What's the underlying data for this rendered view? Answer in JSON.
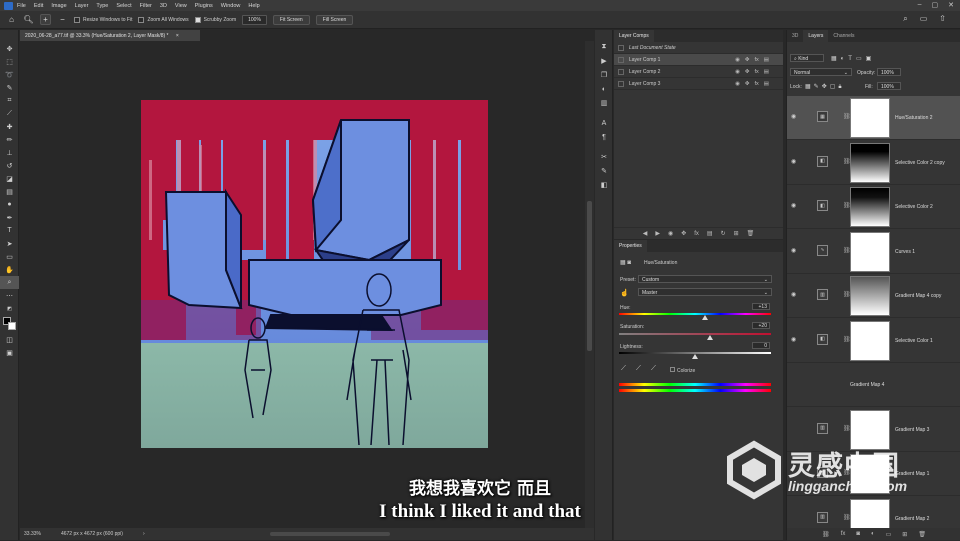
{
  "menubar": {
    "items": [
      "File",
      "Edit",
      "Image",
      "Layer",
      "Type",
      "Select",
      "Filter",
      "3D",
      "View",
      "Plugins",
      "Window",
      "Help"
    ]
  },
  "options": {
    "resize_windows": "Resize Windows to Fit",
    "zoom_all": "Zoom All Windows",
    "scrubby_zoom": "Scrubby Zoom",
    "zoom_value": "100%",
    "fit_screen": "Fit Screen",
    "fill_screen": "Fill Screen"
  },
  "document": {
    "tab_title": "2020_06-28_a77.tif @ 33.3% (Hue/Saturation 2, Layer Mask/8) *",
    "zoom": "33.33%",
    "dimensions": "4672 px x 4672 px (600 ppi)"
  },
  "layer_comps": {
    "tabs": [
      "Layer Comps"
    ],
    "last_state": "Last Document State",
    "items": [
      "Layer Comp 1",
      "Layer Comp 2",
      "Layer Comp 3"
    ]
  },
  "properties": {
    "tab": "Properties",
    "adjustment": "Hue/Saturation",
    "preset_label": "Preset:",
    "preset_value": "Custom",
    "channel_value": "Master",
    "hue_label": "Hue:",
    "hue_value": "+13",
    "saturation_label": "Saturation:",
    "saturation_value": "+20",
    "lightness_label": "Lightness:",
    "lightness_value": "0",
    "colorize_label": "Colorize"
  },
  "layers_panel": {
    "tabs": [
      "3D",
      "Layers",
      "Channels"
    ],
    "kind": "Kind",
    "blend_mode": "Normal",
    "opacity_label": "Opacity:",
    "opacity_value": "100%",
    "lock_label": "Lock:",
    "fill_label": "Fill:",
    "fill_value": "100%",
    "layers": [
      {
        "name": "Hue/Saturation 2",
        "visible": true,
        "selected": true
      },
      {
        "name": "Selective Color 2 copy",
        "visible": true
      },
      {
        "name": "Selective Color 2",
        "visible": true
      },
      {
        "name": "Curves 1",
        "visible": true
      },
      {
        "name": "Gradient Map 4 copy",
        "visible": true
      },
      {
        "name": "Selective Color 1",
        "visible": true
      },
      {
        "name": "Gradient Map 4",
        "visible": false
      },
      {
        "name": "Gradient Map 3",
        "visible": false
      },
      {
        "name": "Gradient Map 1",
        "visible": false
      },
      {
        "name": "Gradient Map 2",
        "visible": false
      }
    ]
  },
  "subtitle": {
    "zh": "我想我喜欢它 而且",
    "en": "I think I liked it and that"
  },
  "watermark": {
    "name": "灵感中国",
    "url": "lingganchina.com"
  },
  "colors": {
    "brand": "#2d6bc8",
    "panel": "#353535",
    "artwork_red": "#b3163e",
    "artwork_sky": "#6d8fe0",
    "artwork_ground": "#8ab3a5"
  }
}
